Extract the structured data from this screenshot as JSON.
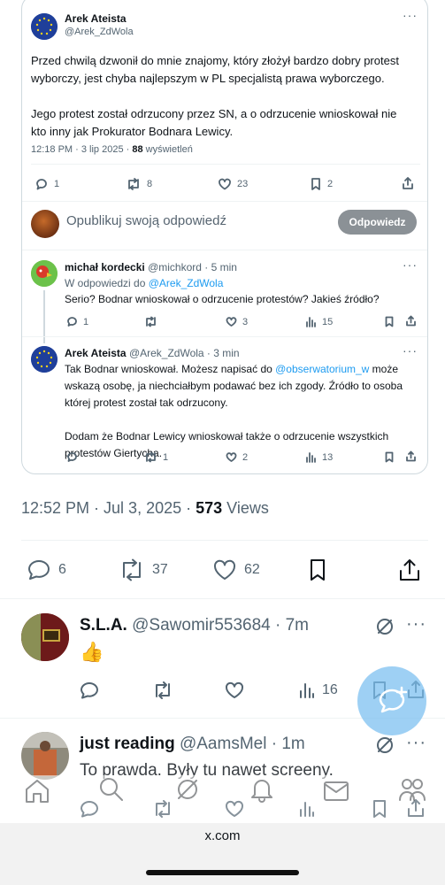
{
  "quoted": {
    "author_name": "Arek Ateista",
    "author_handle": "@Arek_ZdWola",
    "paragraph1": "Przed chwilą dzwonił do mnie znajomy, który złożył bardzo dobry protest",
    "paragraph1b": "wyborczy, jest chyba najlepszym w PL specjalistą prawa wyborczego.",
    "paragraph2": "Jego protest został odrzucony przez SN, a o odrzucenie wnioskował nie",
    "paragraph2b": "kto inny jak Prokurator Bodnara Lewicy.",
    "time": "12:18 PM · 3 lip 2025 · ",
    "views_count": "88",
    "views_label": " wyświetleń",
    "replies": "1",
    "reposts": "8",
    "likes": "23",
    "bookmarks": "2",
    "reply_placeholder": "Opublikuj swoją odpowiedź",
    "reply_button": "Odpowiedz"
  },
  "reply1": {
    "name": "michał kordecki",
    "handle": "@michkord",
    "time": " · 5 min",
    "replying_prefix": "W odpowiedzi do ",
    "replying_to": "@Arek_ZdWola",
    "text": "Serio? Bodnar wnioskował o odrzucenie protestów? Jakieś źródło?",
    "replies": "1",
    "likes": "3",
    "views": "15"
  },
  "reply2": {
    "name": "Arek Ateista",
    "handle": "@Arek_ZdWola",
    "time": " · 3 min",
    "line1a": "Tak Bodnar wnioskował. Możesz napisać do ",
    "line1_link": "@obserwatorium_w",
    "line1b": " może",
    "line2": "wskazą osobę, ja niechciałbym podawać bez ich zgody. Źródło to osoba",
    "line3": "której protest został tak odrzucony.",
    "line4": "Dodam że Bodnar Lewicy wnioskował także o odrzucenie wszystkich",
    "line5": "protestów Giertycha.",
    "reposts": "1",
    "likes": "2",
    "views": "13"
  },
  "main": {
    "time": "12:52 PM · Jul 3, 2025 · ",
    "views_count": "573",
    "views_label": " Views",
    "replies": "6",
    "reposts": "37",
    "likes": "62"
  },
  "comments": [
    {
      "name": "S.L.A.",
      "handle": "@Sawomir553684",
      "time": " · 7m",
      "text": "👍",
      "views": "16"
    },
    {
      "name": "just reading",
      "handle": "@AamsMel",
      "time": " · 1m",
      "text": "To prawda. Były tu nawet screeny."
    }
  ],
  "browser": {
    "url": "x.com"
  }
}
